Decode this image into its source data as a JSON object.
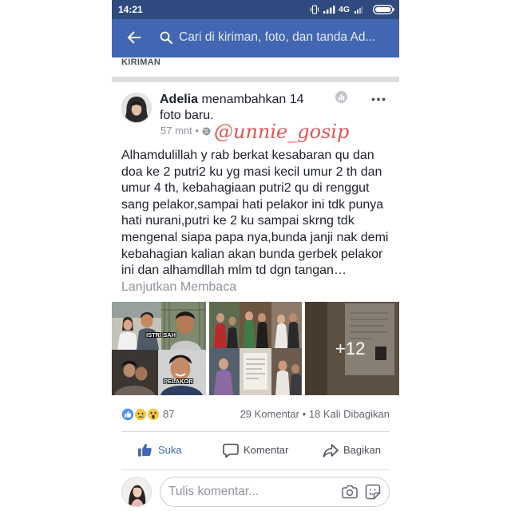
{
  "status_bar": {
    "time": "14:21",
    "network_type": "4G"
  },
  "header": {
    "search_placeholder": "Cari di kiriman, foto, dan tanda Ad..."
  },
  "section": {
    "label": "KIRIMAN"
  },
  "post": {
    "author": "Adelia",
    "activity": "menambahkan 14 foto baru.",
    "timestamp": "57 mnt",
    "dot": "•",
    "watermark": "@unnie_gosip",
    "body_lines": [
      "Alhamdulillah y rab berkat kesabaran qu dan",
      "doa ke 2 putri2 ku yg masi kecil umur 2 th dan",
      "umur 4 th, kebahagiaan putri2 qu di renggut",
      "sang pelakor,sampai hati pelakor ini tdk punya",
      "hati nurani,putri ke 2 ku sampai skrng tdk",
      "mengenal siapa papa nya,bunda janji nak demi",
      "kebahagian kalian akan bunda gerbek pelakor",
      "ini dan alhamdllah mlm td dgn tangan…"
    ],
    "read_more": "Lanjutkan Membaca",
    "photos": {
      "labels": [
        "ISTRI SAH",
        "PELAKOR"
      ],
      "more_count": "+12"
    },
    "reactions": {
      "icons": [
        "like-reaction-icon",
        "sad-reaction-icon",
        "wow-reaction-icon"
      ],
      "count": "87"
    },
    "comments": "29 Komentar",
    "shares": "18 Kali Dibagikan"
  },
  "actions": {
    "like": "Suka",
    "comment": "Komentar",
    "share": "Bagikan"
  },
  "comment_box": {
    "placeholder": "Tulis komentar..."
  },
  "icons": {
    "header": [
      "back-arrow-icon",
      "search-icon"
    ],
    "post": [
      "insights-icon",
      "more-options-icon",
      "globe-icon"
    ],
    "actions": [
      "thumbs-up-icon",
      "comment-bubble-icon",
      "share-arrow-icon"
    ],
    "comment_box": [
      "camera-icon",
      "sticker-icon"
    ]
  },
  "colors": {
    "status_bar": "#2f4a7f",
    "brand_blue": "#4267b2",
    "watermark": "#e45454",
    "text": "#1d2129",
    "muted": "#90949c",
    "liked": "#4267b2"
  }
}
